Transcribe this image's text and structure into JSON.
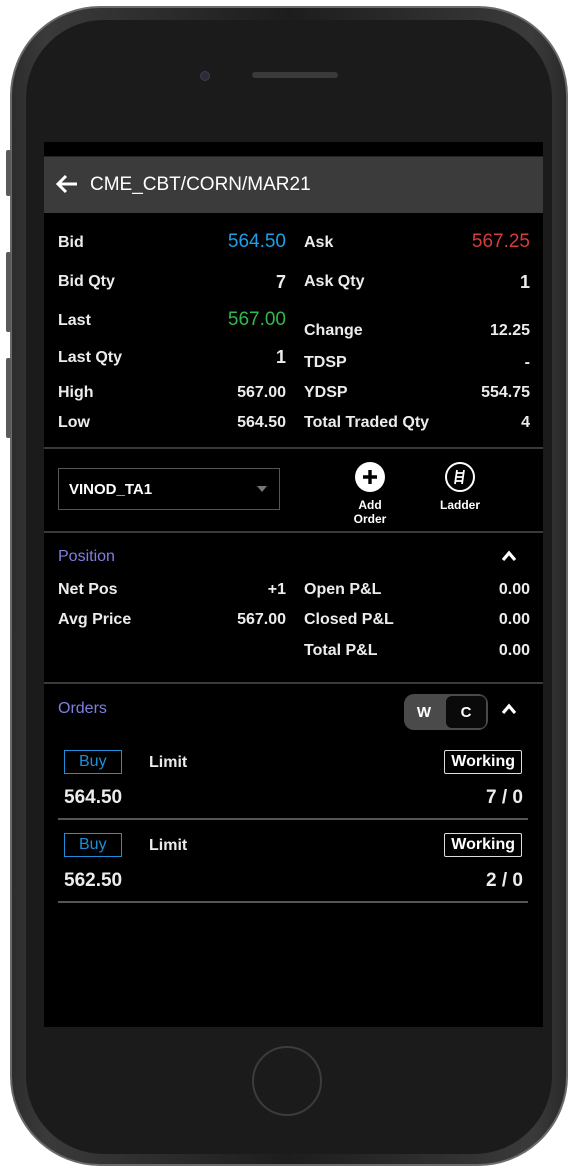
{
  "header": {
    "title": "CME_CBT/CORN/MAR21"
  },
  "quote": {
    "bid_label": "Bid",
    "bid": "564.50",
    "ask_label": "Ask",
    "ask": "567.25",
    "bid_qty_label": "Bid Qty",
    "bid_qty": "7",
    "ask_qty_label": "Ask Qty",
    "ask_qty": "1",
    "last_label": "Last",
    "last": "567.00",
    "change_label": "Change",
    "change": "12.25",
    "last_qty_label": "Last Qty",
    "last_qty": "1",
    "tdsp_label": "TDSP",
    "tdsp": "-",
    "high_label": "High",
    "high": "567.00",
    "ydsp_label": "YDSP",
    "ydsp": "554.75",
    "low_label": "Low",
    "low": "564.50",
    "total_traded_label": "Total Traded Qty",
    "total_traded": "4",
    "colors": {
      "bid": "#1ea0e8",
      "ask": "#d63c3c",
      "last": "#35b84a"
    }
  },
  "account": {
    "selected": "VINOD_TA1"
  },
  "tools": {
    "add_order": "Add Order",
    "ladder": "Ladder"
  },
  "position": {
    "title": "Position",
    "net_pos_label": "Net Pos",
    "net_pos": "+1",
    "open_pl_label": "Open P&L",
    "open_pl": "0.00",
    "avg_price_label": "Avg Price",
    "avg_price": "567.00",
    "closed_pl_label": "Closed P&L",
    "closed_pl": "0.00",
    "total_pl_label": "Total P&L",
    "total_pl": "0.00"
  },
  "orders": {
    "title": "Orders",
    "toggle_w": "W",
    "toggle_c": "C",
    "items": [
      {
        "side": "Buy",
        "type": "Limit",
        "status": "Working",
        "price": "564.50",
        "qty": "7 / 0"
      },
      {
        "side": "Buy",
        "type": "Limit",
        "status": "Working",
        "price": "562.50",
        "qty": "2 / 0"
      }
    ]
  }
}
